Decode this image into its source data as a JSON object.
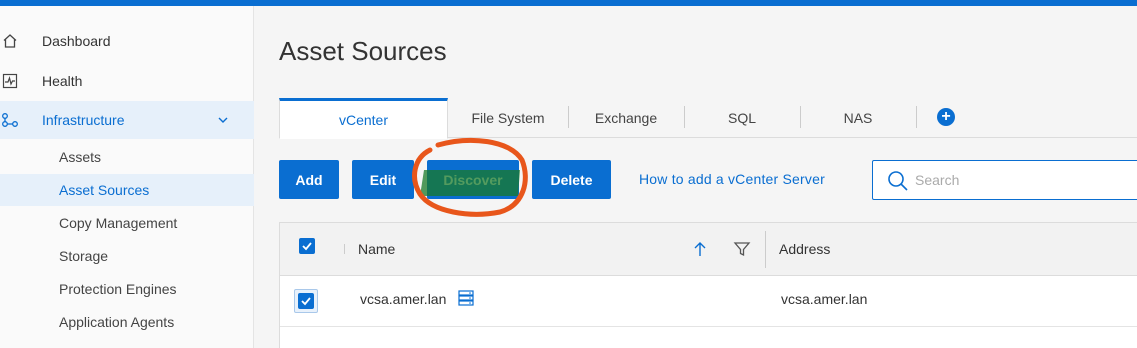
{
  "sidebar": {
    "items": [
      {
        "label": "Dashboard",
        "icon": "home-icon"
      },
      {
        "label": "Health",
        "icon": "health-icon"
      },
      {
        "label": "Infrastructure",
        "icon": "infrastructure-icon"
      }
    ],
    "sub_items": [
      {
        "label": "Assets"
      },
      {
        "label": "Asset Sources"
      },
      {
        "label": "Copy Management"
      },
      {
        "label": "Storage"
      },
      {
        "label": "Protection Engines"
      },
      {
        "label": "Application Agents"
      }
    ]
  },
  "main": {
    "title": "Asset Sources",
    "tabs": [
      {
        "label": "vCenter"
      },
      {
        "label": "File System"
      },
      {
        "label": "Exchange"
      },
      {
        "label": "SQL"
      },
      {
        "label": "NAS"
      }
    ],
    "add_tab_symbol": "+",
    "toolbar": {
      "add": "Add",
      "edit": "Edit",
      "discover": "Discover",
      "delete": "Delete",
      "help_link": "How to add a vCenter Server",
      "search_placeholder": "Search"
    },
    "table": {
      "columns": [
        "Name",
        "Address"
      ],
      "rows": [
        {
          "name": "vcsa.amer.lan",
          "address": "vcsa.amer.lan"
        }
      ]
    }
  },
  "colors": {
    "accent": "#0a6ed1",
    "annotation": "#e8561b"
  }
}
